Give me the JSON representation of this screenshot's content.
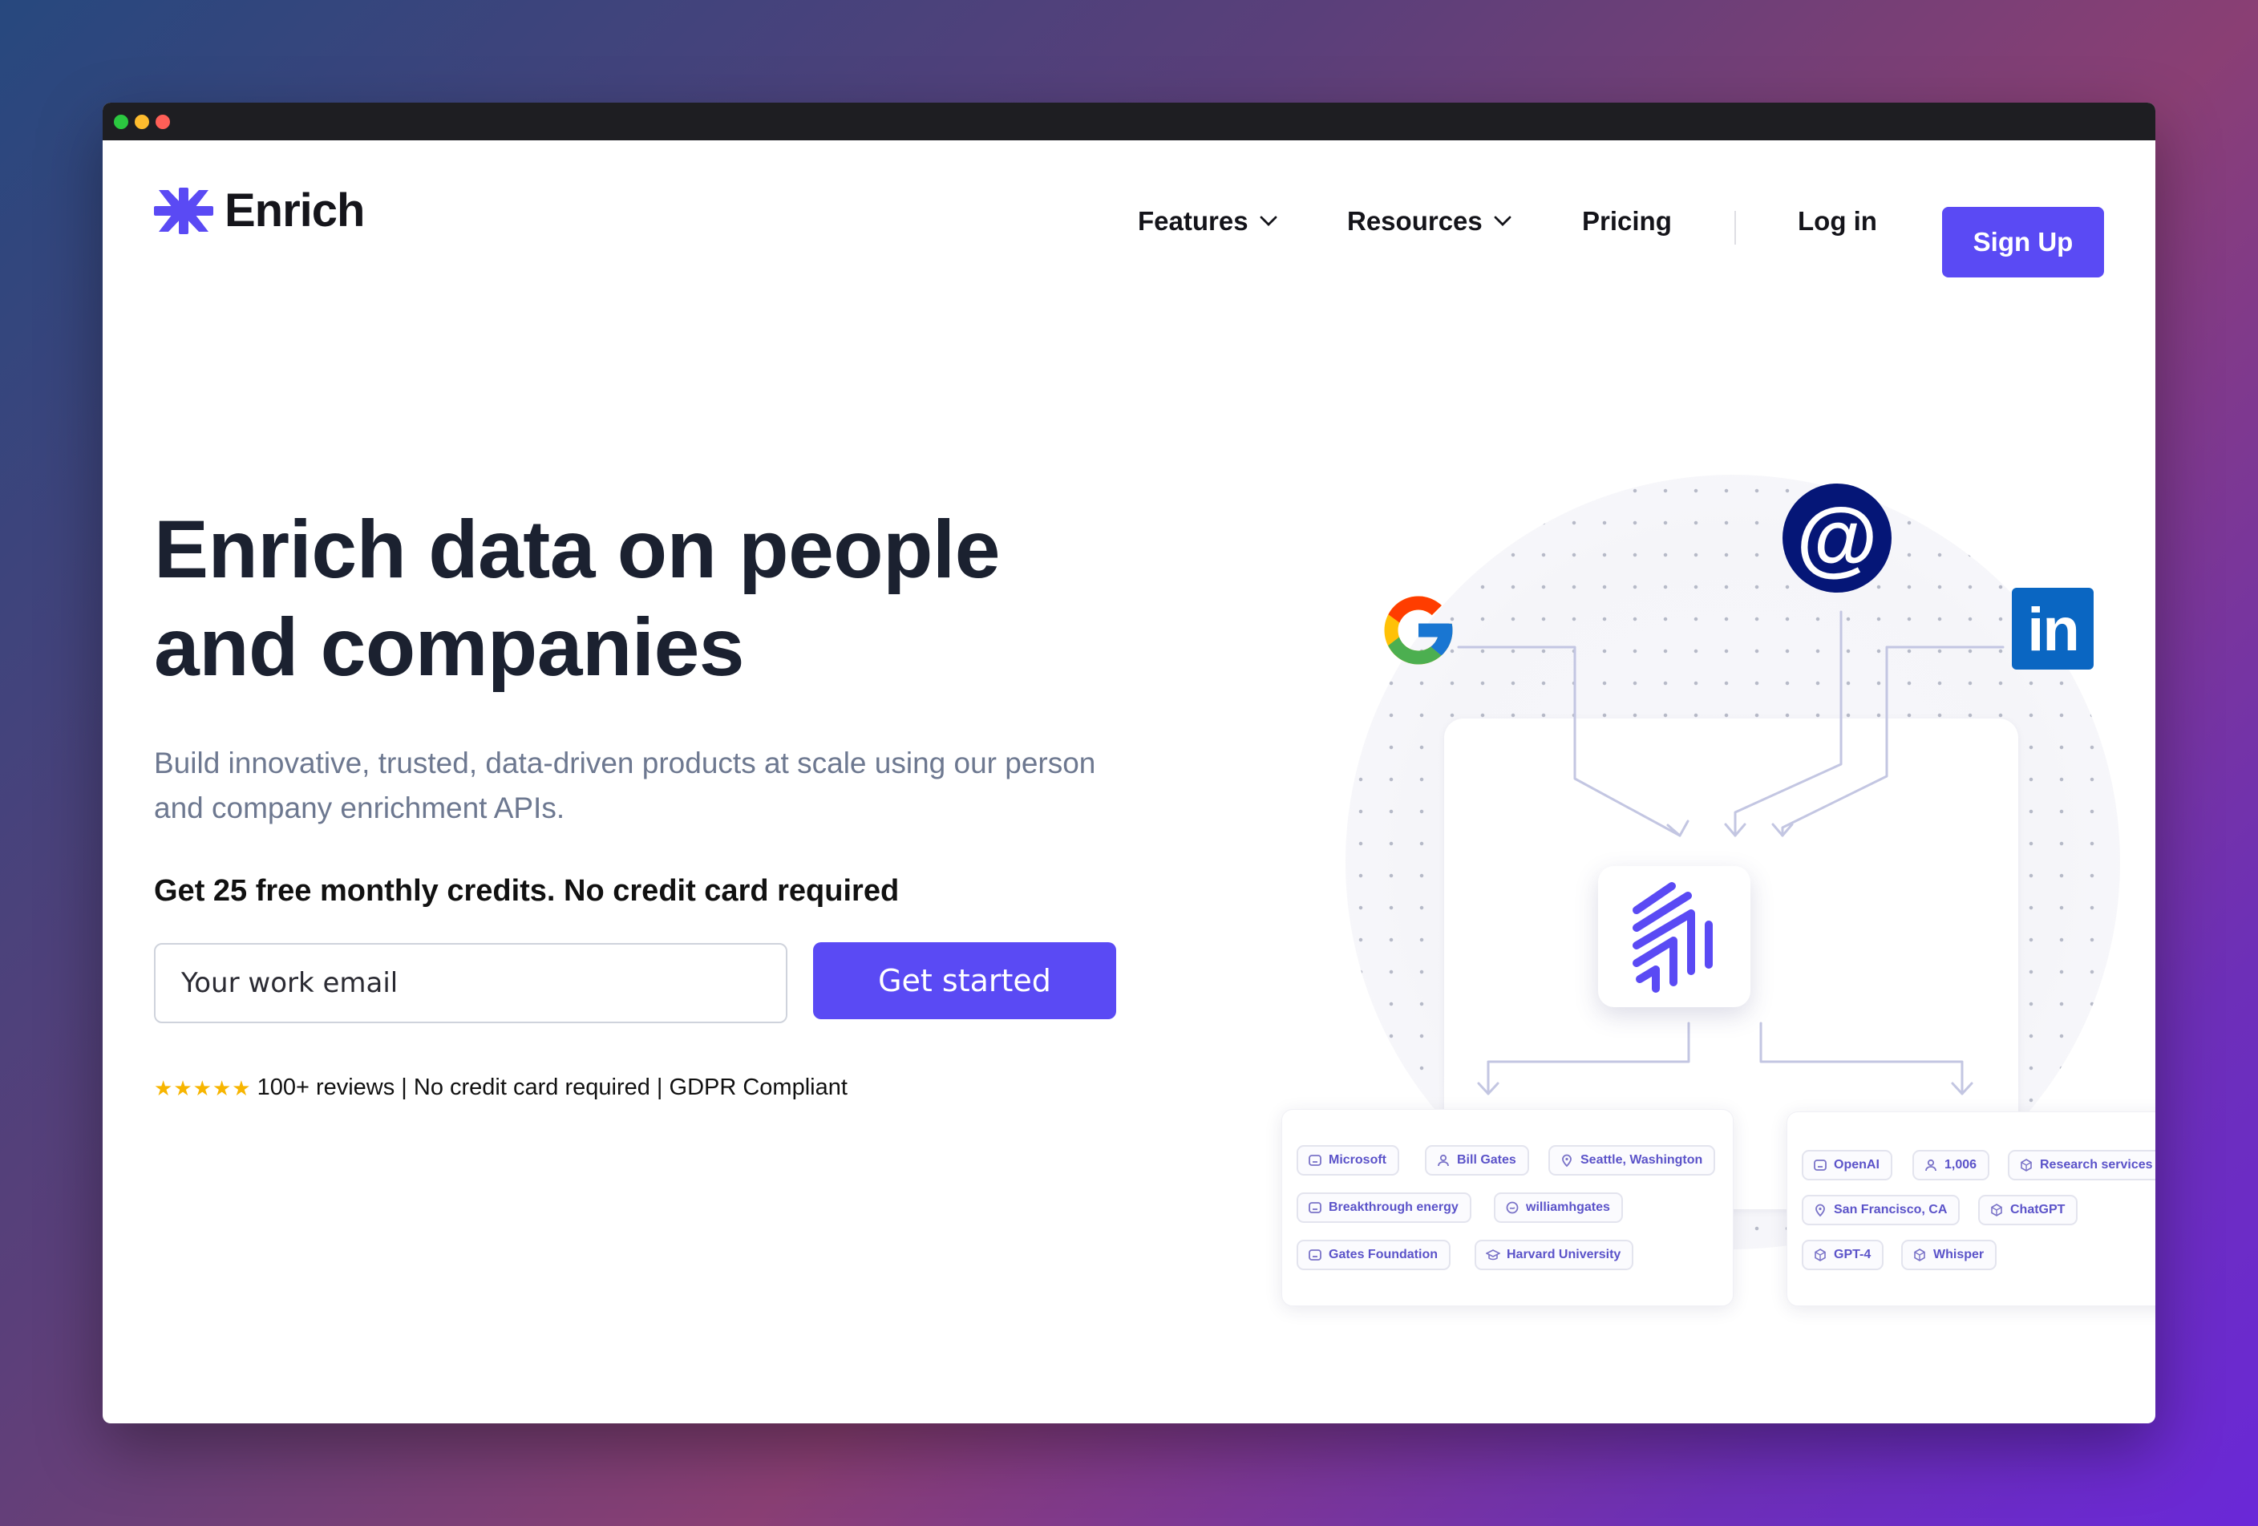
{
  "window": {
    "controls": [
      "close",
      "minimize",
      "maximize"
    ]
  },
  "nav": {
    "logo_text": "Enrich",
    "items": [
      {
        "label": "Features",
        "has_dropdown": true
      },
      {
        "label": "Resources",
        "has_dropdown": true
      },
      {
        "label": "Pricing",
        "has_dropdown": false
      }
    ],
    "login_label": "Log in",
    "signup_label": "Sign Up"
  },
  "hero": {
    "title_line1": "Enrich data on people",
    "title_line2": "and companies",
    "subtitle_line1": "Build innovative, trusted, data-driven products at scale using our person",
    "subtitle_line2": "and company enrichment APIs.",
    "credits": "Get 25 free monthly credits. No credit card required",
    "email_placeholder": "Your work email",
    "cta_label": "Get started",
    "rating_stars": 5,
    "reviews_text": "100+ reviews | No credit card required | GDPR Compliant"
  },
  "illustration": {
    "sources": [
      "google-logo",
      "email-at",
      "linkedin-logo"
    ],
    "linkedin_text": "in",
    "email_symbol": "@",
    "person_chips": [
      {
        "icon": "building-icon",
        "label": "Microsoft"
      },
      {
        "icon": "person-icon",
        "label": "Bill Gates"
      },
      {
        "icon": "location-icon",
        "label": "Seattle, Washington"
      },
      {
        "icon": "building-icon",
        "label": "Breakthrough energy"
      },
      {
        "icon": "social-icon",
        "label": "williamhgates"
      },
      {
        "icon": "building-icon",
        "label": "Gates Foundation"
      },
      {
        "icon": "graduation-icon",
        "label": "Harvard University"
      }
    ],
    "company_chips": [
      {
        "icon": "building-icon",
        "label": "OpenAI"
      },
      {
        "icon": "person-icon",
        "label": "1,006"
      },
      {
        "icon": "box-icon",
        "label": "Research services"
      },
      {
        "icon": "location-icon",
        "label": "San Francisco, CA"
      },
      {
        "icon": "box-icon",
        "label": "ChatGPT"
      },
      {
        "icon": "box-icon",
        "label": "GPT-4"
      },
      {
        "icon": "box-icon",
        "label": "Whisper"
      }
    ]
  },
  "colors": {
    "accent": "#5a4af4",
    "heading": "#1b2130",
    "subtitle": "#6d7890",
    "star": "#f7b500",
    "chip_text": "#5b53c9",
    "linkedin": "#0a66c2",
    "email_circle": "#051677"
  }
}
